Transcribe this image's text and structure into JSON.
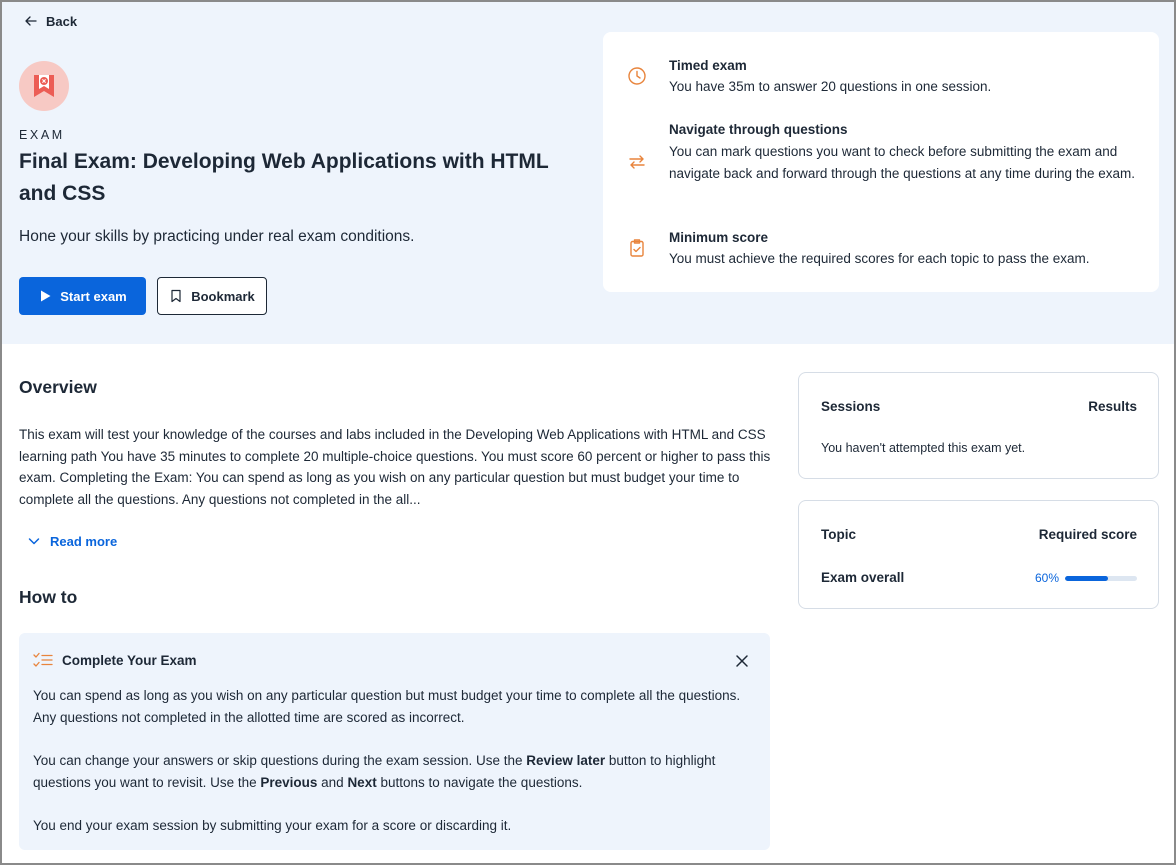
{
  "nav": {
    "back_label": "Back"
  },
  "hero": {
    "eyebrow": "EXAM",
    "title": "Final Exam: Developing Web Applications with HTML and CSS",
    "subtitle": "Hone your skills by practicing under real exam conditions.",
    "start_label": "Start exam",
    "bookmark_label": "Bookmark"
  },
  "info": {
    "items": [
      {
        "icon": "clock-icon",
        "heading": "Timed exam",
        "text": "You have 35m to answer 20 questions in one session."
      },
      {
        "icon": "swap-arrows-icon",
        "heading": "Navigate through questions",
        "text": "You can mark questions you want to check before submitting the exam and navigate back and forward through the questions at any time during the exam."
      },
      {
        "icon": "clipboard-check-icon",
        "heading": "Minimum score",
        "text": "You must achieve the required scores for each topic to pass the exam."
      }
    ]
  },
  "overview": {
    "heading": "Overview",
    "text": "This exam will test your knowledge of the courses and labs included in the Developing Web Applications with HTML and CSS learning path You have 35 minutes to complete 20 multiple-choice questions.  You must score 60 percent or higher to pass this exam. Completing the Exam: You can spend as long as you wish on any particular question but must budget your time to complete all the questions. Any questions not completed in the all...",
    "read_more_label": "Read more"
  },
  "howto": {
    "heading": "How to",
    "box_title": "Complete Your Exam",
    "p1": "You can spend as long as you wish on any particular question but must budget your time to complete all the questions. Any questions not completed in the allotted time are scored as incorrect.",
    "p2_a": "You can change your answers or skip questions during the exam session. Use the ",
    "p2_b": "Review later",
    "p2_c": " button to highlight questions you want to revisit. Use the ",
    "p2_d": "Previous",
    "p2_e": " and ",
    "p2_f": "Next",
    "p2_g": " buttons to navigate the questions.",
    "p3": "You end your exam session by submitting your exam for a score or discarding it."
  },
  "sessions": {
    "sessions_label": "Sessions",
    "results_label": "Results",
    "empty_note": "You haven't attempted this exam yet."
  },
  "topics": {
    "topic_label": "Topic",
    "required_label": "Required score",
    "row_label": "Exam overall",
    "score_text": "60%",
    "score_fraction": 0.6
  },
  "colors": {
    "accent": "#0a65dc",
    "hero_bg": "#eef4fc",
    "icon_orange": "#e8843c",
    "logo_red": "#ec5d55"
  }
}
